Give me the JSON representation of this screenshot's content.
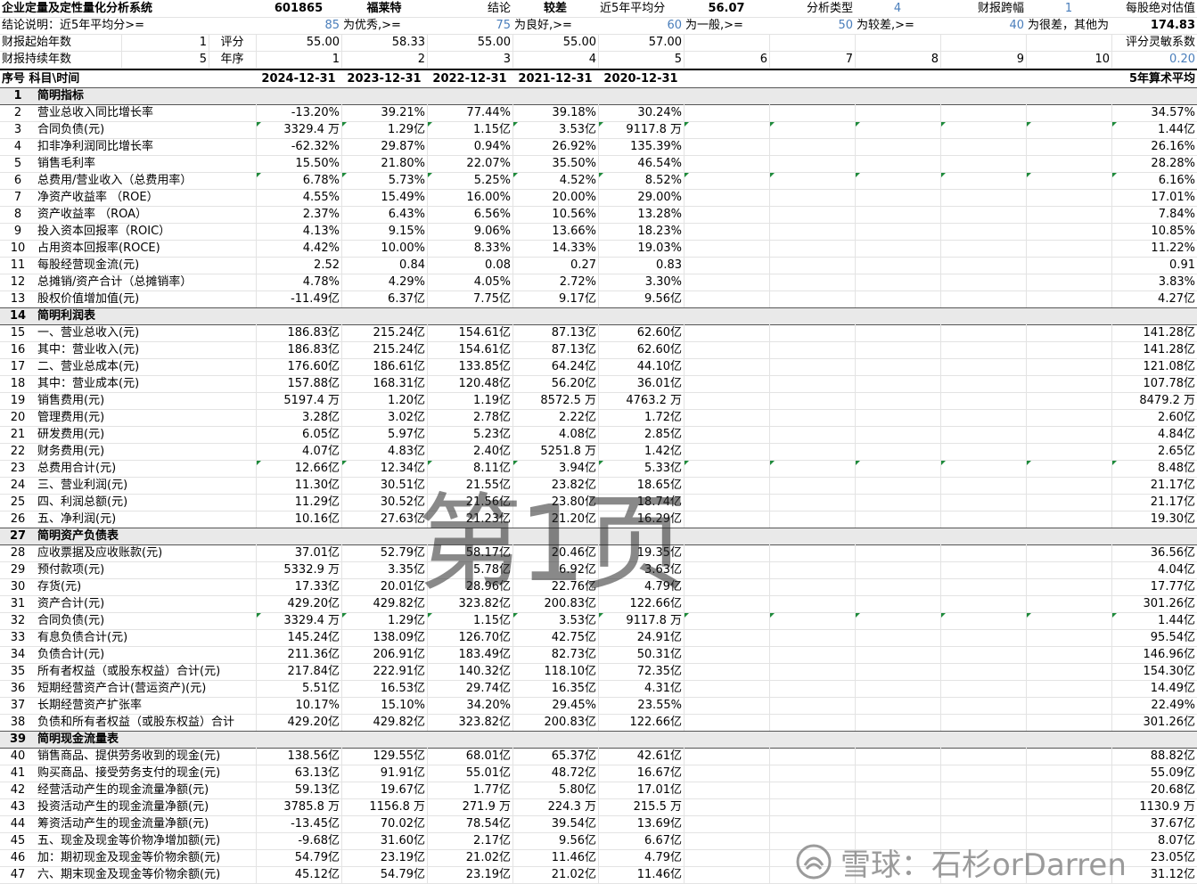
{
  "header": {
    "row1": [
      {
        "text": "企业定量及定性量化分析系统",
        "col": "c1",
        "align": "l",
        "bold": true
      },
      {
        "text": "601865",
        "col": "c2",
        "align": "m",
        "bold": true
      },
      {
        "text": "福莱特",
        "col": "c3",
        "align": "m",
        "bold": true
      },
      {
        "text": "结论",
        "col": "c4",
        "align": "r"
      },
      {
        "text": "较差",
        "col": "c5",
        "align": "m",
        "bold": true
      },
      {
        "text": "近5年平均分",
        "col": "c6",
        "align": "l"
      },
      {
        "text": "56.07",
        "col": "c7",
        "align": "m",
        "bold": true
      },
      {
        "text": "分析类型",
        "col": "c8",
        "align": "r"
      },
      {
        "text": "4",
        "col": "c9",
        "align": "m",
        "blue": true
      },
      {
        "text": "财报跨幅",
        "col": "c10",
        "align": "r"
      },
      {
        "text": "1",
        "col": "c11",
        "align": "m",
        "blue": true
      },
      {
        "text": "每股绝对估值",
        "col": "c12",
        "align": "r"
      }
    ],
    "row2": [
      {
        "text": "结论说明：近5年平均分>=",
        "col": "c1",
        "align": "l"
      },
      {
        "text": "85",
        "col": "c2",
        "align": "r",
        "blue": true
      },
      {
        "text": "为优秀,>=",
        "col": "c3",
        "align": "l"
      },
      {
        "text": "75",
        "col": "c4",
        "align": "r",
        "blue": true
      },
      {
        "text": "为良好,>=",
        "col": "c5",
        "align": "l"
      },
      {
        "text": "60",
        "col": "c6",
        "align": "r",
        "blue": true
      },
      {
        "text": "为一般,>=",
        "col": "c7",
        "align": "l"
      },
      {
        "text": "50",
        "col": "c8",
        "align": "r",
        "blue": true
      },
      {
        "text": "为较差,>=",
        "col": "c9",
        "align": "l"
      },
      {
        "text": "40",
        "col": "c10",
        "align": "r",
        "blue": true
      },
      {
        "text": "为很差，其他为",
        "col": "c11",
        "align": "l"
      },
      {
        "text": "174.83",
        "col": "c12",
        "align": "r",
        "bold": true
      }
    ],
    "row3": [
      {
        "text": "财报起始年数",
        "col": "c1a",
        "align": "l"
      },
      {
        "text": "1",
        "col": "c1b",
        "align": "r"
      },
      {
        "text": "评分",
        "col": "c1c",
        "align": "m"
      },
      {
        "text": "55.00",
        "col": "c2",
        "align": "r"
      },
      {
        "text": "58.33",
        "col": "c3",
        "align": "r"
      },
      {
        "text": "55.00",
        "col": "c4",
        "align": "r"
      },
      {
        "text": "55.00",
        "col": "c5",
        "align": "r"
      },
      {
        "text": "57.00",
        "col": "c6",
        "align": "r"
      },
      {
        "text": "评分灵敏系数",
        "col": "c12",
        "align": "r"
      }
    ],
    "row4": [
      {
        "text": "财报持续年数",
        "col": "c1a",
        "align": "l"
      },
      {
        "text": "5",
        "col": "c1b",
        "align": "r"
      },
      {
        "text": "年序",
        "col": "c1c",
        "align": "m"
      },
      {
        "text": "1",
        "col": "c2",
        "align": "r"
      },
      {
        "text": "2",
        "col": "c3",
        "align": "r"
      },
      {
        "text": "3",
        "col": "c4",
        "align": "r"
      },
      {
        "text": "4",
        "col": "c5",
        "align": "r"
      },
      {
        "text": "5",
        "col": "c6",
        "align": "r"
      },
      {
        "text": "6",
        "col": "c7",
        "align": "r"
      },
      {
        "text": "7",
        "col": "c8",
        "align": "r"
      },
      {
        "text": "8",
        "col": "c9",
        "align": "r"
      },
      {
        "text": "9",
        "col": "c10",
        "align": "r"
      },
      {
        "text": "10",
        "col": "c11",
        "align": "r"
      },
      {
        "text": "0.20",
        "col": "c12",
        "align": "r",
        "blue": true
      }
    ]
  },
  "table_header": {
    "label": "序号 科目\\时间",
    "dates": [
      "2024-12-31",
      "2023-12-31",
      "2022-12-31",
      "2021-12-31",
      "2020-12-31"
    ],
    "avg": "5年算术平均"
  },
  "rows": [
    {
      "section": true,
      "no": "1",
      "name": "简明指标"
    },
    {
      "no": "2",
      "name": "营业总收入同比增长率",
      "v": [
        "-13.20%",
        "39.21%",
        "77.44%",
        "39.18%",
        "30.24%"
      ],
      "avg": "34.57%"
    },
    {
      "no": "3",
      "name": "合同负债(元)",
      "v": [
        "3329.4 万",
        "1.29亿",
        "1.15亿",
        "3.53亿",
        "9117.8 万"
      ],
      "avg": "1.44亿",
      "tri": [
        1,
        2,
        3,
        4,
        5,
        6,
        7,
        8,
        9,
        10,
        11
      ]
    },
    {
      "no": "4",
      "name": "扣非净利润同比增长率",
      "v": [
        "-62.32%",
        "29.87%",
        "0.94%",
        "26.92%",
        "135.39%"
      ],
      "avg": "26.16%"
    },
    {
      "no": "5",
      "name": "销售毛利率",
      "v": [
        "15.50%",
        "21.80%",
        "22.07%",
        "35.50%",
        "46.54%"
      ],
      "avg": "28.28%"
    },
    {
      "no": "6",
      "name": "总费用/营业收入（总费用率）",
      "v": [
        "6.78%",
        "5.73%",
        "5.25%",
        "4.52%",
        "8.52%"
      ],
      "avg": "6.16%",
      "tri": [
        1,
        2,
        3,
        4,
        5,
        6,
        7,
        8,
        9,
        10,
        11
      ]
    },
    {
      "no": "7",
      "name": "净资产收益率 （ROE）",
      "v": [
        "4.55%",
        "15.49%",
        "16.00%",
        "20.00%",
        "29.00%"
      ],
      "avg": "17.01%"
    },
    {
      "no": "8",
      "name": "资产收益率 （ROA）",
      "v": [
        "2.37%",
        "6.43%",
        "6.56%",
        "10.56%",
        "13.28%"
      ],
      "avg": "7.84%"
    },
    {
      "no": "9",
      "name": "投入资本回报率（ROIC）",
      "v": [
        "4.13%",
        "9.15%",
        "9.06%",
        "13.66%",
        "18.23%"
      ],
      "avg": "10.85%"
    },
    {
      "no": "10",
      "name": "占用资本回报率(ROCE)",
      "v": [
        "4.42%",
        "10.00%",
        "8.33%",
        "14.33%",
        "19.03%"
      ],
      "avg": "11.22%"
    },
    {
      "no": "11",
      "name": "每股经营现金流(元)",
      "v": [
        "2.52",
        "0.84",
        "0.08",
        "0.27",
        "0.83"
      ],
      "avg": "0.91"
    },
    {
      "no": "12",
      "name": "总摊销/资产合计（总摊销率）",
      "v": [
        "4.78%",
        "4.29%",
        "4.05%",
        "2.72%",
        "3.30%"
      ],
      "avg": "3.83%"
    },
    {
      "no": "13",
      "name": "股权价值增加值(元)",
      "v": [
        "-11.49亿",
        "6.37亿",
        "7.75亿",
        "9.17亿",
        "9.56亿"
      ],
      "avg": "4.27亿"
    },
    {
      "section": true,
      "no": "14",
      "name": "简明利润表"
    },
    {
      "no": "15",
      "name": "一、营业总收入(元)",
      "v": [
        "186.83亿",
        "215.24亿",
        "154.61亿",
        "87.13亿",
        "62.60亿"
      ],
      "avg": "141.28亿"
    },
    {
      "no": "16",
      "name": "其中：营业收入(元)",
      "v": [
        "186.83亿",
        "215.24亿",
        "154.61亿",
        "87.13亿",
        "62.60亿"
      ],
      "avg": "141.28亿"
    },
    {
      "no": "17",
      "name": "二、营业总成本(元)",
      "v": [
        "176.60亿",
        "186.61亿",
        "133.85亿",
        "64.24亿",
        "44.10亿"
      ],
      "avg": "121.08亿"
    },
    {
      "no": "18",
      "name": "其中：营业成本(元)",
      "v": [
        "157.88亿",
        "168.31亿",
        "120.48亿",
        "56.20亿",
        "36.01亿"
      ],
      "avg": "107.78亿"
    },
    {
      "no": "19",
      "name": "销售费用(元)",
      "v": [
        "5197.4 万",
        "1.20亿",
        "1.19亿",
        "8572.5 万",
        "4763.2 万"
      ],
      "avg": "8479.2 万"
    },
    {
      "no": "20",
      "name": "管理费用(元)",
      "v": [
        "3.28亿",
        "3.02亿",
        "2.78亿",
        "2.22亿",
        "1.72亿"
      ],
      "avg": "2.60亿"
    },
    {
      "no": "21",
      "name": "研发费用(元)",
      "v": [
        "6.05亿",
        "5.97亿",
        "5.23亿",
        "4.08亿",
        "2.85亿"
      ],
      "avg": "4.84亿"
    },
    {
      "no": "22",
      "name": "财务费用(元)",
      "v": [
        "4.07亿",
        "4.83亿",
        "2.40亿",
        "5251.8 万",
        "1.42亿"
      ],
      "avg": "2.65亿"
    },
    {
      "no": "23",
      "name": "总费用合计(元)",
      "v": [
        "12.66亿",
        "12.34亿",
        "8.11亿",
        "3.94亿",
        "5.33亿"
      ],
      "avg": "8.48亿",
      "tri": [
        1,
        2,
        3,
        4,
        5,
        6,
        7,
        8,
        9,
        10,
        11
      ]
    },
    {
      "no": "24",
      "name": "三、营业利润(元)",
      "v": [
        "11.30亿",
        "30.51亿",
        "21.55亿",
        "23.82亿",
        "18.65亿"
      ],
      "avg": "21.17亿"
    },
    {
      "no": "25",
      "name": "四、利润总额(元)",
      "v": [
        "11.29亿",
        "30.52亿",
        "21.56亿",
        "23.80亿",
        "18.74亿"
      ],
      "avg": "21.17亿"
    },
    {
      "no": "26",
      "name": "五、净利润(元)",
      "v": [
        "10.16亿",
        "27.63亿",
        "21.23亿",
        "21.20亿",
        "16.29亿"
      ],
      "avg": "19.30亿"
    },
    {
      "section": true,
      "no": "27",
      "name": "简明资产负债表"
    },
    {
      "no": "28",
      "name": "应收票据及应收账款(元)",
      "v": [
        "37.01亿",
        "52.79亿",
        "58.17亿",
        "20.46亿",
        "19.35亿"
      ],
      "avg": "36.56亿"
    },
    {
      "no": "29",
      "name": "预付款项(元)",
      "v": [
        "5332.9 万",
        "3.35亿",
        "5.78亿",
        "6.92亿",
        "3.63亿"
      ],
      "avg": "4.04亿"
    },
    {
      "no": "30",
      "name": "存货(元)",
      "v": [
        "17.33亿",
        "20.01亿",
        "28.96亿",
        "22.76亿",
        "4.79亿"
      ],
      "avg": "17.77亿"
    },
    {
      "no": "31",
      "name": "资产合计(元)",
      "v": [
        "429.20亿",
        "429.82亿",
        "323.82亿",
        "200.83亿",
        "122.66亿"
      ],
      "avg": "301.26亿"
    },
    {
      "no": "32",
      "name": "合同负债(元)",
      "v": [
        "3329.4 万",
        "1.29亿",
        "1.15亿",
        "3.53亿",
        "9117.8 万"
      ],
      "avg": "1.44亿",
      "tri": [
        1,
        2,
        3,
        4,
        5,
        6,
        7,
        8,
        9,
        10,
        11
      ]
    },
    {
      "no": "33",
      "name": "有息负债合计(元)",
      "v": [
        "145.24亿",
        "138.09亿",
        "126.70亿",
        "42.75亿",
        "24.91亿"
      ],
      "avg": "95.54亿"
    },
    {
      "no": "34",
      "name": "负债合计(元)",
      "v": [
        "211.36亿",
        "206.91亿",
        "183.49亿",
        "82.73亿",
        "50.31亿"
      ],
      "avg": "146.96亿"
    },
    {
      "no": "35",
      "name": "所有者权益（或股东权益）合计(元)",
      "v": [
        "217.84亿",
        "222.91亿",
        "140.32亿",
        "118.10亿",
        "72.35亿"
      ],
      "avg": "154.30亿"
    },
    {
      "no": "36",
      "name": "短期经营资产合计(营运资产)(元)",
      "v": [
        "5.51亿",
        "16.53亿",
        "29.74亿",
        "16.35亿",
        "4.31亿"
      ],
      "avg": "14.49亿"
    },
    {
      "no": "37",
      "name": "长期经营资产扩张率",
      "v": [
        "10.17%",
        "15.10%",
        "34.20%",
        "29.45%",
        "23.55%"
      ],
      "avg": "22.49%"
    },
    {
      "no": "38",
      "name": "负债和所有者权益（或股东权益）合计",
      "v": [
        "429.20亿",
        "429.82亿",
        "323.82亿",
        "200.83亿",
        "122.66亿"
      ],
      "avg": "301.26亿"
    },
    {
      "section": true,
      "no": "39",
      "name": "简明现金流量表"
    },
    {
      "no": "40",
      "name": "销售商品、提供劳务收到的现金(元)",
      "v": [
        "138.56亿",
        "129.55亿",
        "68.01亿",
        "65.37亿",
        "42.61亿"
      ],
      "avg": "88.82亿"
    },
    {
      "no": "41",
      "name": "购买商品、接受劳务支付的现金(元)",
      "v": [
        "63.13亿",
        "91.91亿",
        "55.01亿",
        "48.72亿",
        "16.67亿"
      ],
      "avg": "55.09亿"
    },
    {
      "no": "42",
      "name": "经营活动产生的现金流量净额(元)",
      "v": [
        "59.13亿",
        "19.67亿",
        "1.77亿",
        "5.80亿",
        "17.01亿"
      ],
      "avg": "20.68亿"
    },
    {
      "no": "43",
      "name": "投资活动产生的现金流量净额(元)",
      "v": [
        "3785.8 万",
        "1156.8 万",
        "271.9 万",
        "224.3 万",
        "215.5 万"
      ],
      "avg": "1130.9 万"
    },
    {
      "no": "44",
      "name": "筹资活动产生的现金流量净额(元)",
      "v": [
        "-13.45亿",
        "70.02亿",
        "78.54亿",
        "39.54亿",
        "13.69亿"
      ],
      "avg": "37.67亿"
    },
    {
      "no": "45",
      "name": "五、现金及现金等价物净增加额(元)",
      "v": [
        "-9.68亿",
        "31.60亿",
        "2.17亿",
        "9.56亿",
        "6.67亿"
      ],
      "avg": "8.07亿"
    },
    {
      "no": "46",
      "name": "加：期初现金及现金等价物余额(元)",
      "v": [
        "54.79亿",
        "23.19亿",
        "21.02亿",
        "11.46亿",
        "4.79亿"
      ],
      "avg": "23.05亿"
    },
    {
      "no": "47",
      "name": "六、期末现金及现金等价物余额(元)",
      "v": [
        "45.12亿",
        "54.79亿",
        "23.19亿",
        "21.02亿",
        "11.46亿"
      ],
      "avg": "31.12亿"
    }
  ],
  "watermark": "第1页",
  "brand": "雪球：石杉orDarren"
}
